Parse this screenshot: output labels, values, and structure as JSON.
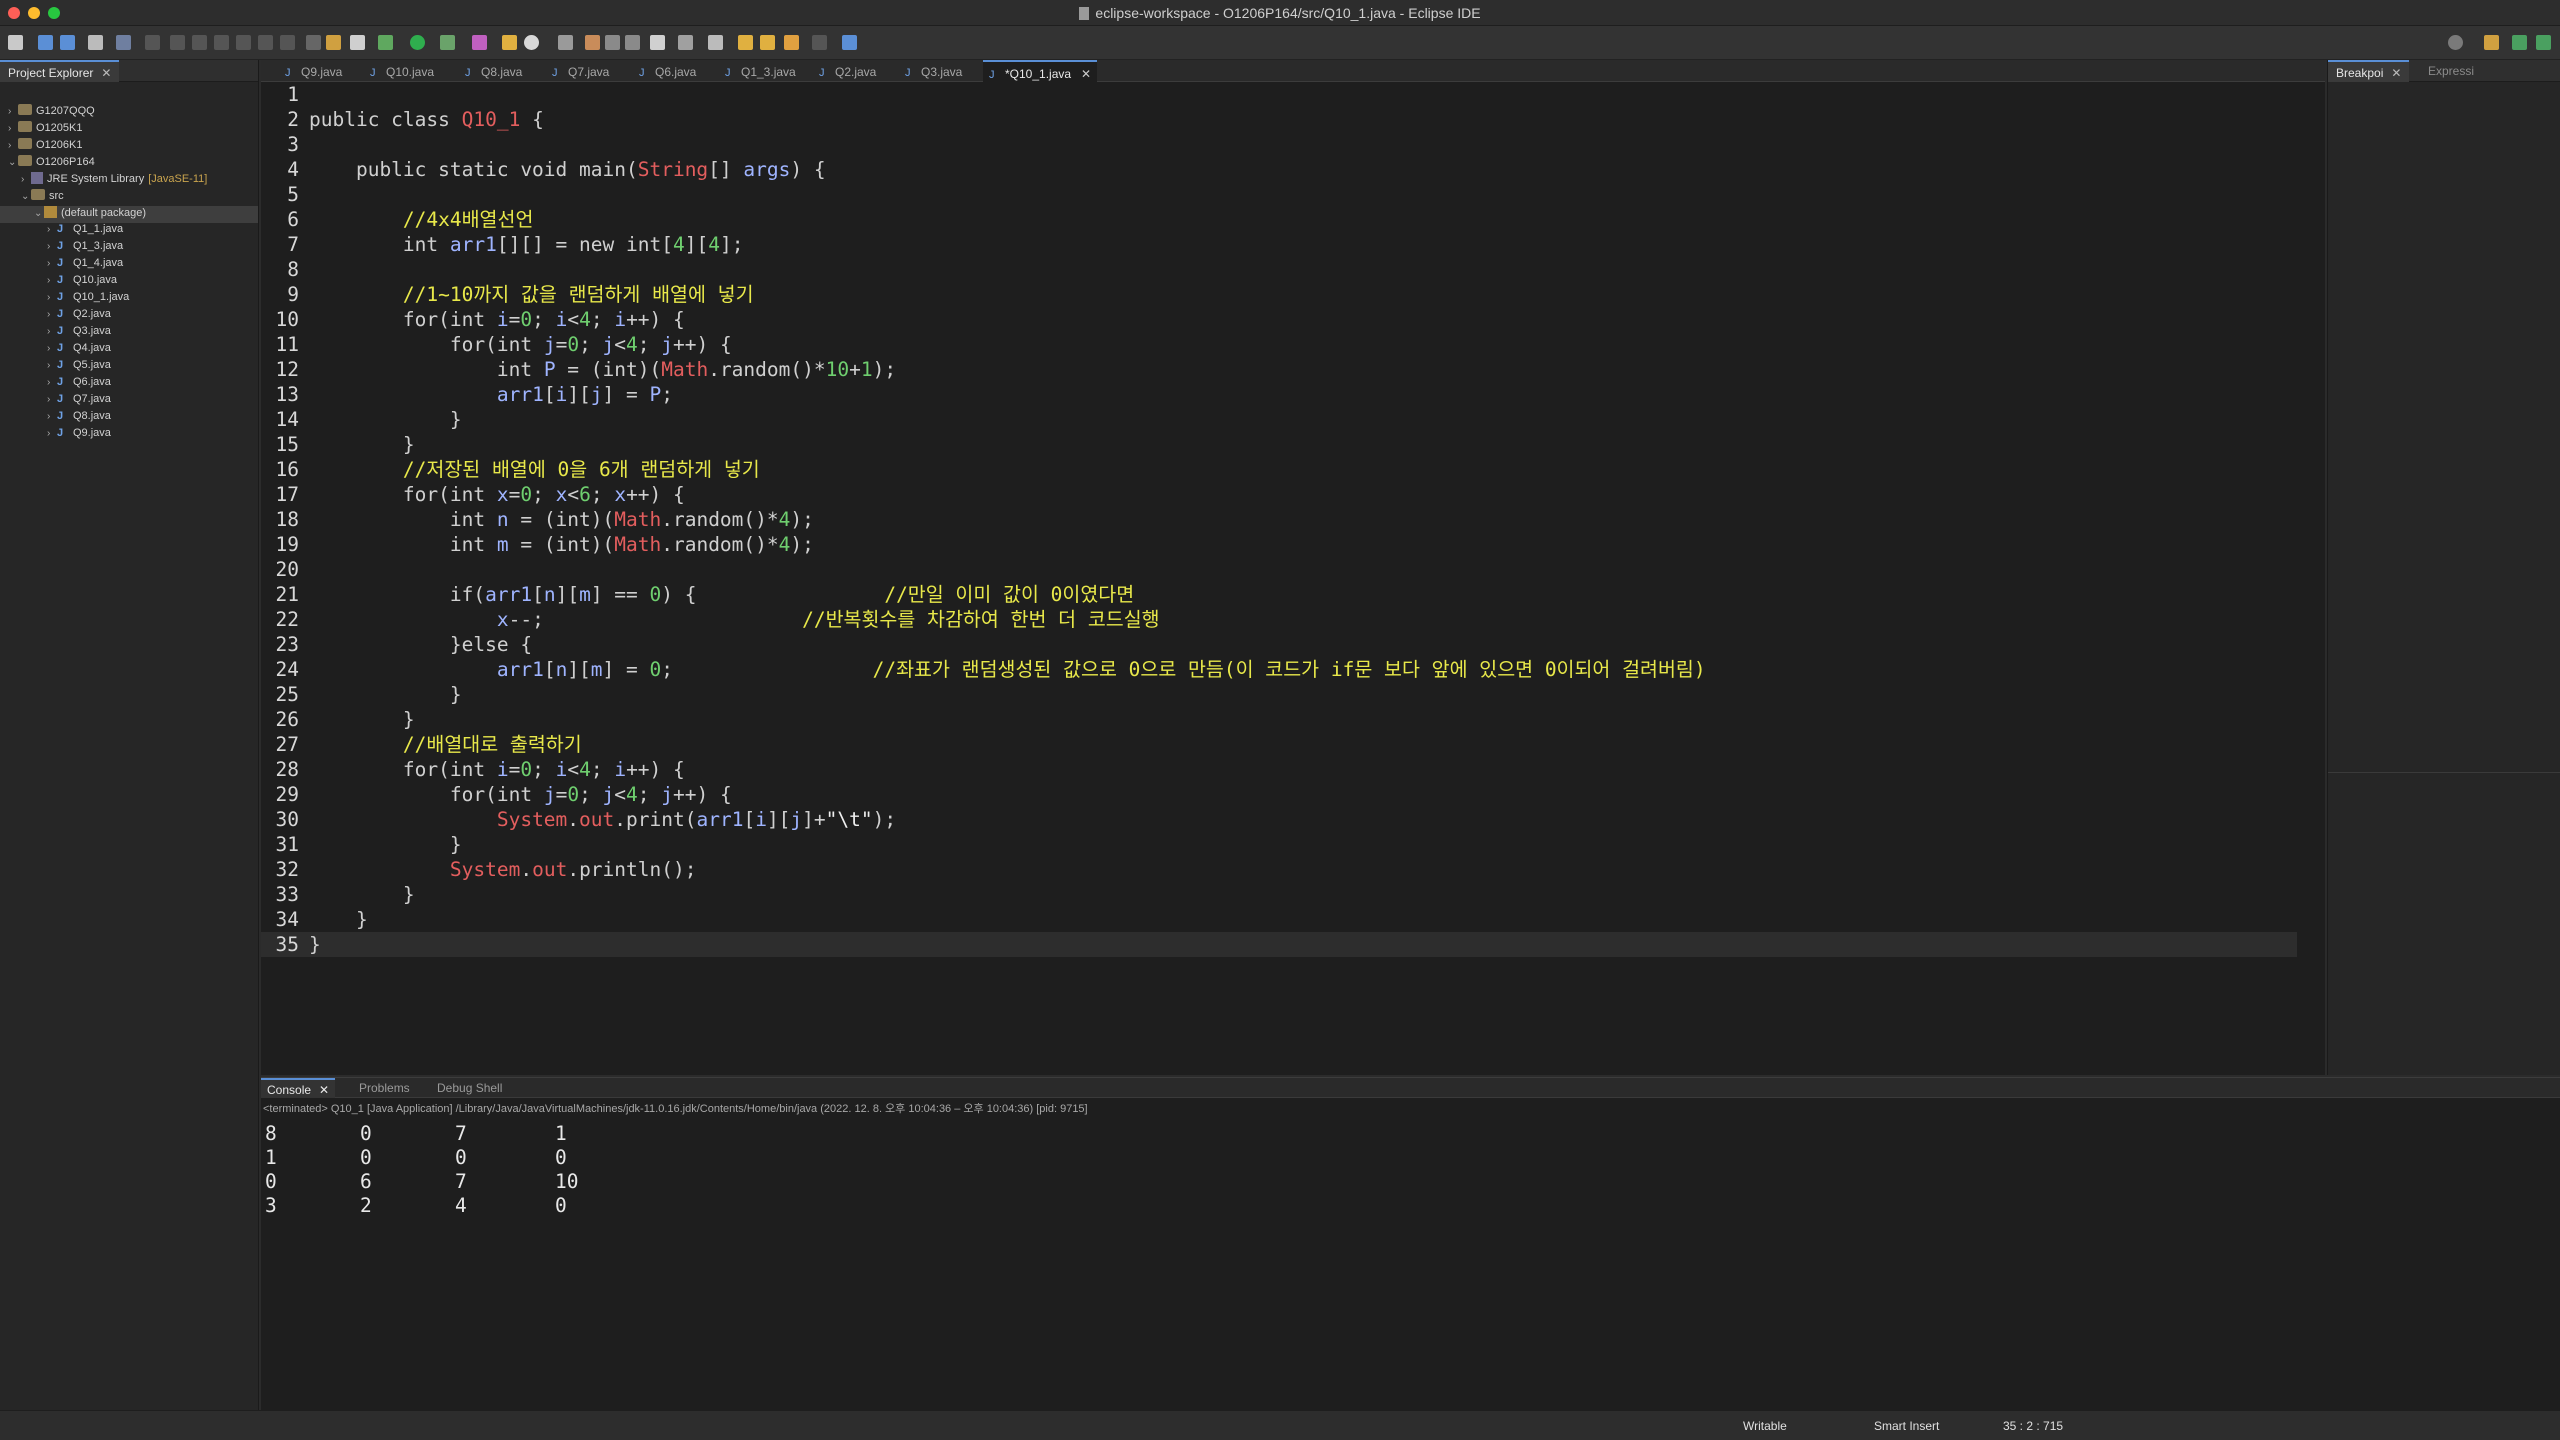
{
  "window": {
    "title": "eclipse-workspace - O1206P164/src/Q10_1.java - Eclipse IDE"
  },
  "explorer": {
    "tab_label": "Project Explorer",
    "items": [
      {
        "label": "G1207QQQ",
        "kind": "project",
        "depth": 0,
        "expanded": false
      },
      {
        "label": "O1205K1",
        "kind": "project",
        "depth": 0,
        "expanded": false
      },
      {
        "label": "O1206K1",
        "kind": "project",
        "depth": 0,
        "expanded": false
      },
      {
        "label": "O1206P164",
        "kind": "project",
        "depth": 0,
        "expanded": true
      },
      {
        "label": "JRE System Library",
        "deco": "[JavaSE-11]",
        "kind": "library",
        "depth": 1,
        "expanded": false
      },
      {
        "label": "src",
        "kind": "folder",
        "depth": 1,
        "expanded": true
      },
      {
        "label": "(default package)",
        "kind": "package",
        "depth": 2,
        "expanded": true,
        "selected": true
      },
      {
        "label": "Q1_1.java",
        "kind": "java",
        "depth": 3
      },
      {
        "label": "Q1_3.java",
        "kind": "java",
        "depth": 3
      },
      {
        "label": "Q1_4.java",
        "kind": "java",
        "depth": 3
      },
      {
        "label": "Q10.java",
        "kind": "java",
        "depth": 3
      },
      {
        "label": "Q10_1.java",
        "kind": "java",
        "depth": 3
      },
      {
        "label": "Q2.java",
        "kind": "java",
        "depth": 3
      },
      {
        "label": "Q3.java",
        "kind": "java",
        "depth": 3
      },
      {
        "label": "Q4.java",
        "kind": "java",
        "depth": 3
      },
      {
        "label": "Q5.java",
        "kind": "java",
        "depth": 3
      },
      {
        "label": "Q6.java",
        "kind": "java",
        "depth": 3
      },
      {
        "label": "Q7.java",
        "kind": "java",
        "depth": 3
      },
      {
        "label": "Q8.java",
        "kind": "java",
        "depth": 3
      },
      {
        "label": "Q9.java",
        "kind": "java",
        "depth": 3
      }
    ]
  },
  "editor": {
    "tabs": [
      {
        "label": "Q9.java",
        "active": false
      },
      {
        "label": "Q10.java",
        "active": false
      },
      {
        "label": "Q8.java",
        "active": false
      },
      {
        "label": "Q7.java",
        "active": false
      },
      {
        "label": "Q6.java",
        "active": false
      },
      {
        "label": "Q1_3.java",
        "active": false
      },
      {
        "label": "Q2.java",
        "active": false
      },
      {
        "label": "Q3.java",
        "active": false
      },
      {
        "label": "*Q10_1.java",
        "active": true
      }
    ],
    "current_line": 35,
    "lines": [
      {
        "n": "1",
        "segs": []
      },
      {
        "n": "2",
        "segs": [
          [
            "kw",
            "public class "
          ],
          [
            "cls",
            "Q10_1"
          ],
          [
            "kw",
            " {"
          ]
        ]
      },
      {
        "n": "3",
        "segs": []
      },
      {
        "n": "4",
        "segs": [
          [
            "kw",
            "    public static void "
          ],
          [
            "kw",
            "main("
          ],
          [
            "cls",
            "String"
          ],
          [
            "kw",
            "[] "
          ],
          [
            "var",
            "args"
          ],
          [
            "kw",
            ") {"
          ]
        ]
      },
      {
        "n": "5",
        "segs": []
      },
      {
        "n": "6",
        "segs": [
          [
            "kw",
            "        "
          ],
          [
            "cm",
            "//4x4배열선언"
          ]
        ]
      },
      {
        "n": "7",
        "segs": [
          [
            "kw",
            "        int "
          ],
          [
            "var",
            "arr1"
          ],
          [
            "kw",
            "[][] = new int["
          ],
          [
            "num",
            "4"
          ],
          [
            "kw",
            "]["
          ],
          [
            "num",
            "4"
          ],
          [
            "kw",
            "];"
          ]
        ]
      },
      {
        "n": "8",
        "segs": []
      },
      {
        "n": "9",
        "segs": [
          [
            "kw",
            "        "
          ],
          [
            "cm",
            "//1~10까지 값을 랜덤하게 배열에 넣기"
          ]
        ]
      },
      {
        "n": "10",
        "segs": [
          [
            "kw",
            "        for(int "
          ],
          [
            "var",
            "i"
          ],
          [
            "kw",
            "="
          ],
          [
            "num",
            "0"
          ],
          [
            "kw",
            "; "
          ],
          [
            "var",
            "i"
          ],
          [
            "kw",
            "<"
          ],
          [
            "num",
            "4"
          ],
          [
            "kw",
            "; "
          ],
          [
            "var",
            "i"
          ],
          [
            "kw",
            "++) {"
          ]
        ]
      },
      {
        "n": "11",
        "segs": [
          [
            "kw",
            "            for(int "
          ],
          [
            "var",
            "j"
          ],
          [
            "kw",
            "="
          ],
          [
            "num",
            "0"
          ],
          [
            "kw",
            "; "
          ],
          [
            "var",
            "j"
          ],
          [
            "kw",
            "<"
          ],
          [
            "num",
            "4"
          ],
          [
            "kw",
            "; "
          ],
          [
            "var",
            "j"
          ],
          [
            "kw",
            "++) {"
          ]
        ]
      },
      {
        "n": "12",
        "segs": [
          [
            "kw",
            "                int "
          ],
          [
            "var",
            "P"
          ],
          [
            "kw",
            " = (int)("
          ],
          [
            "cls",
            "Math"
          ],
          [
            "kw",
            ".random()*"
          ],
          [
            "num",
            "10"
          ],
          [
            "kw",
            "+"
          ],
          [
            "num",
            "1"
          ],
          [
            "kw",
            ");"
          ]
        ]
      },
      {
        "n": "13",
        "segs": [
          [
            "kw",
            "                "
          ],
          [
            "var",
            "arr1"
          ],
          [
            "kw",
            "["
          ],
          [
            "var",
            "i"
          ],
          [
            "kw",
            "]["
          ],
          [
            "var",
            "j"
          ],
          [
            "kw",
            "] = "
          ],
          [
            "var",
            "P"
          ],
          [
            "kw",
            ";"
          ]
        ]
      },
      {
        "n": "14",
        "segs": [
          [
            "kw",
            "            }"
          ]
        ]
      },
      {
        "n": "15",
        "segs": [
          [
            "kw",
            "        }"
          ]
        ]
      },
      {
        "n": "16",
        "segs": [
          [
            "kw",
            "        "
          ],
          [
            "cm",
            "//저장된 배열에 0을 6개 랜덤하게 넣기"
          ]
        ]
      },
      {
        "n": "17",
        "segs": [
          [
            "kw",
            "        for(int "
          ],
          [
            "var",
            "x"
          ],
          [
            "kw",
            "="
          ],
          [
            "num",
            "0"
          ],
          [
            "kw",
            "; "
          ],
          [
            "var",
            "x"
          ],
          [
            "kw",
            "<"
          ],
          [
            "num",
            "6"
          ],
          [
            "kw",
            "; "
          ],
          [
            "var",
            "x"
          ],
          [
            "kw",
            "++) {"
          ]
        ]
      },
      {
        "n": "18",
        "segs": [
          [
            "kw",
            "            int "
          ],
          [
            "var",
            "n"
          ],
          [
            "kw",
            " = (int)("
          ],
          [
            "cls",
            "Math"
          ],
          [
            "kw",
            ".random()*"
          ],
          [
            "num",
            "4"
          ],
          [
            "kw",
            ");"
          ]
        ]
      },
      {
        "n": "19",
        "segs": [
          [
            "kw",
            "            int "
          ],
          [
            "var",
            "m"
          ],
          [
            "kw",
            " = (int)("
          ],
          [
            "cls",
            "Math"
          ],
          [
            "kw",
            ".random()*"
          ],
          [
            "num",
            "4"
          ],
          [
            "kw",
            ");"
          ]
        ]
      },
      {
        "n": "20",
        "segs": []
      },
      {
        "n": "21",
        "segs": [
          [
            "kw",
            "            if("
          ],
          [
            "var",
            "arr1"
          ],
          [
            "kw",
            "["
          ],
          [
            "var",
            "n"
          ],
          [
            "kw",
            "]["
          ],
          [
            "var",
            "m"
          ],
          [
            "kw",
            "] == "
          ],
          [
            "num",
            "0"
          ],
          [
            "kw",
            ") {                "
          ],
          [
            "cm",
            "//만일 이미 값이 0이였다면"
          ]
        ]
      },
      {
        "n": "22",
        "segs": [
          [
            "kw",
            "                "
          ],
          [
            "var",
            "x"
          ],
          [
            "kw",
            "--;                      "
          ],
          [
            "cm",
            "//반복횟수를 차감하여 한번 더 코드실행"
          ]
        ]
      },
      {
        "n": "23",
        "segs": [
          [
            "kw",
            "            }else {"
          ]
        ]
      },
      {
        "n": "24",
        "segs": [
          [
            "kw",
            "                "
          ],
          [
            "var",
            "arr1"
          ],
          [
            "kw",
            "["
          ],
          [
            "var",
            "n"
          ],
          [
            "kw",
            "]["
          ],
          [
            "var",
            "m"
          ],
          [
            "kw",
            "] = "
          ],
          [
            "num",
            "0"
          ],
          [
            "kw",
            ";                 "
          ],
          [
            "cm",
            "//좌표가 랜덤생성된 값으로 0으로 만듬(이 코드가 if문 보다 앞에 있으면 0이되어 걸려버림)"
          ]
        ]
      },
      {
        "n": "25",
        "segs": [
          [
            "kw",
            "            }"
          ]
        ]
      },
      {
        "n": "26",
        "segs": [
          [
            "kw",
            "        }"
          ]
        ]
      },
      {
        "n": "27",
        "segs": [
          [
            "kw",
            "        "
          ],
          [
            "cm",
            "//배열대로 출력하기"
          ]
        ]
      },
      {
        "n": "28",
        "segs": [
          [
            "kw",
            "        for(int "
          ],
          [
            "var",
            "i"
          ],
          [
            "kw",
            "="
          ],
          [
            "num",
            "0"
          ],
          [
            "kw",
            "; "
          ],
          [
            "var",
            "i"
          ],
          [
            "kw",
            "<"
          ],
          [
            "num",
            "4"
          ],
          [
            "kw",
            "; "
          ],
          [
            "var",
            "i"
          ],
          [
            "kw",
            "++) {"
          ]
        ]
      },
      {
        "n": "29",
        "segs": [
          [
            "kw",
            "            for(int "
          ],
          [
            "var",
            "j"
          ],
          [
            "kw",
            "="
          ],
          [
            "num",
            "0"
          ],
          [
            "kw",
            "; "
          ],
          [
            "var",
            "j"
          ],
          [
            "kw",
            "<"
          ],
          [
            "num",
            "4"
          ],
          [
            "kw",
            "; "
          ],
          [
            "var",
            "j"
          ],
          [
            "kw",
            "++) {"
          ]
        ]
      },
      {
        "n": "30",
        "segs": [
          [
            "kw",
            "                "
          ],
          [
            "cls",
            "System"
          ],
          [
            "kw",
            "."
          ],
          [
            "cls",
            "out"
          ],
          [
            "kw",
            ".print("
          ],
          [
            "var",
            "arr1"
          ],
          [
            "kw",
            "["
          ],
          [
            "var",
            "i"
          ],
          [
            "kw",
            "]["
          ],
          [
            "var",
            "j"
          ],
          [
            "kw",
            "]+"
          ],
          [
            "str",
            "\"\\t\""
          ],
          [
            "kw",
            ");"
          ]
        ]
      },
      {
        "n": "31",
        "segs": [
          [
            "kw",
            "            }"
          ]
        ]
      },
      {
        "n": "32",
        "segs": [
          [
            "kw",
            "            "
          ],
          [
            "cls",
            "System"
          ],
          [
            "kw",
            "."
          ],
          [
            "cls",
            "out"
          ],
          [
            "kw",
            ".println();"
          ]
        ]
      },
      {
        "n": "33",
        "segs": [
          [
            "kw",
            "        }"
          ]
        ]
      },
      {
        "n": "34",
        "segs": [
          [
            "kw",
            "    }"
          ]
        ]
      },
      {
        "n": "35",
        "segs": [
          [
            "kw",
            "}"
          ]
        ]
      }
    ]
  },
  "right_panel": {
    "tab_breakpoints": "Breakpoi",
    "tab_expressions": "Expressi"
  },
  "console": {
    "tabs": [
      {
        "label": "Console",
        "active": true
      },
      {
        "label": "Problems",
        "active": false
      },
      {
        "label": "Debug Shell",
        "active": false
      }
    ],
    "info": "<terminated> Q10_1 [Java Application] /Library/Java/JavaVirtualMachines/jdk-11.0.16.jdk/Contents/Home/bin/java  (2022. 12. 8. 오후 10:04:36 – 오후 10:04:36) [pid: 9715]",
    "output": [
      [
        "8",
        "0",
        "7",
        "1"
      ],
      [
        "1",
        "0",
        "0",
        "0"
      ],
      [
        "0",
        "6",
        "7",
        "10"
      ],
      [
        "3",
        "2",
        "4",
        "0"
      ]
    ]
  },
  "status": {
    "writable": "Writable",
    "insert_mode": "Smart Insert",
    "position": "35 : 2 : 715"
  }
}
